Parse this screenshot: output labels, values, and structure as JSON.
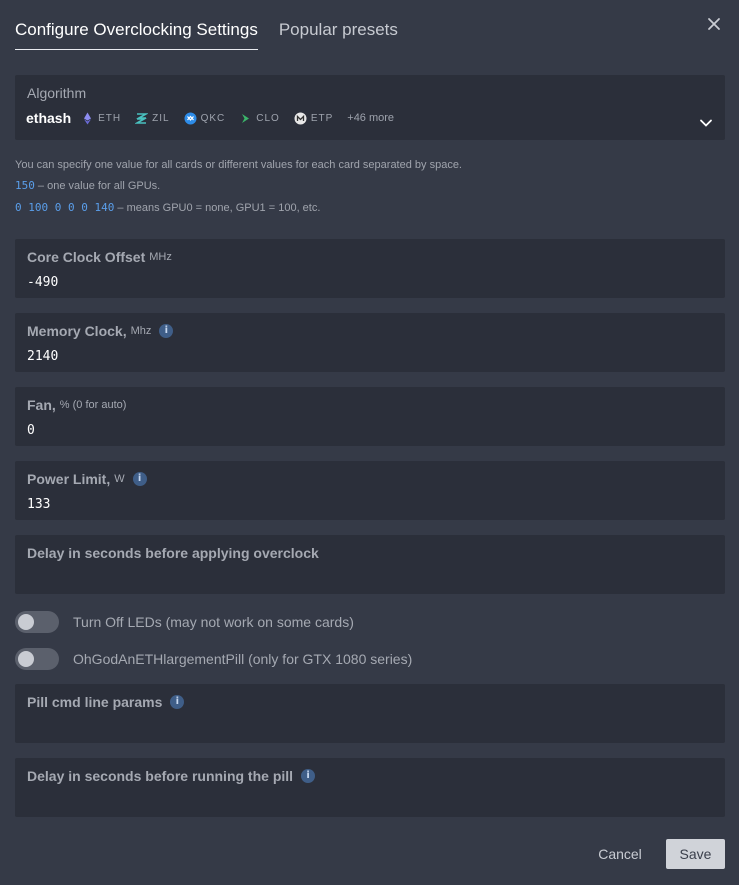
{
  "tabs": [
    {
      "label": "Configure Overclocking Settings",
      "active": true
    },
    {
      "label": "Popular presets",
      "active": false
    }
  ],
  "close_icon": "close-icon",
  "algorithm": {
    "label": "Algorithm",
    "value": "ethash",
    "coins": [
      {
        "ticker": "ETH",
        "icon": "ethereum-icon",
        "color": "#8c8cf0"
      },
      {
        "ticker": "ZIL",
        "icon": "zilliqa-icon",
        "color": "#49c1bf"
      },
      {
        "ticker": "QKC",
        "icon": "quarkchain-icon",
        "color": "#2d8ce8"
      },
      {
        "ticker": "CLO",
        "icon": "callisto-icon",
        "color": "#3bb56a"
      },
      {
        "ticker": "ETP",
        "icon": "metaverse-icon",
        "color": "#e8e8e8"
      }
    ],
    "more": "+46 more"
  },
  "help": {
    "line1": "You can specify one value for all cards or different values for each card separated by space.",
    "line2_code": "150",
    "line2_text": " – one value for all GPUs.",
    "line3_code": "0 100 0 0 0 140",
    "line3_text": " – means GPU0 = none, GPU1 = 100, etc."
  },
  "fields": {
    "core_clock": {
      "label": "Core Clock Offset",
      "unit": "MHz",
      "value": "-490"
    },
    "memory_clock": {
      "label": "Memory Clock,",
      "unit": "Mhz",
      "value": "2140"
    },
    "fan": {
      "label": "Fan,",
      "unit": "% (0 for auto)",
      "value": "0"
    },
    "power_limit": {
      "label": "Power Limit,",
      "unit": "W",
      "value": "133"
    },
    "delay_overclock": {
      "label": "Delay in seconds before applying overclock",
      "value": ""
    },
    "pill_params": {
      "label": "Pill cmd line params",
      "value": ""
    },
    "pill_delay": {
      "label": "Delay in seconds before running the pill",
      "value": ""
    }
  },
  "toggles": {
    "leds": {
      "label": "Turn Off LEDs (may not work on some cards)",
      "on": false
    },
    "pill": {
      "label": "OhGodAnETHlargementPill (only for GTX 1080 series)",
      "on": false
    }
  },
  "info_glyph": "i",
  "buttons": {
    "cancel": "Cancel",
    "save": "Save"
  }
}
